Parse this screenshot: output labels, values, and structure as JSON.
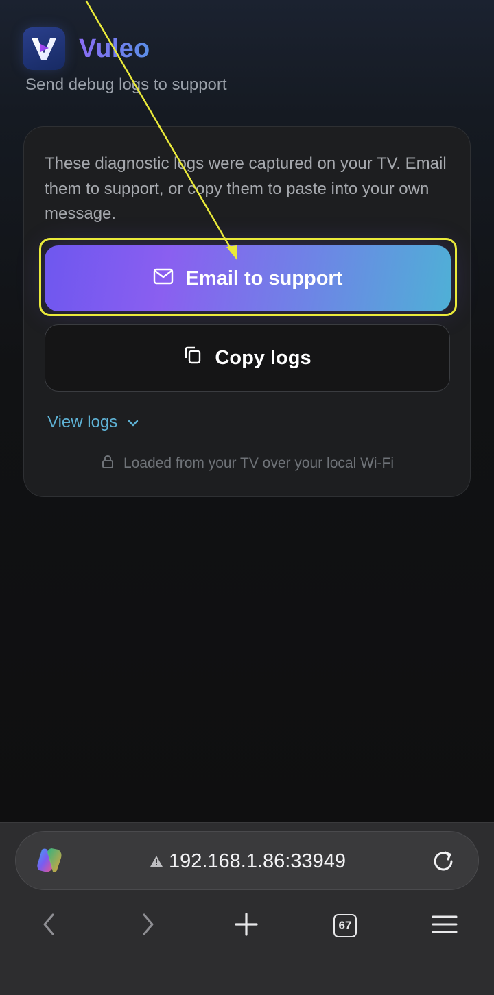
{
  "app": {
    "name": "Vuleo",
    "subtitle": "Send debug logs to support"
  },
  "card": {
    "description": "These diagnostic logs were captured on your TV. Email them to support, or copy them to paste into your own message.",
    "email_button_label": "Email to support",
    "copy_button_label": "Copy logs",
    "view_logs_label": "View logs",
    "footnote": "Loaded from your TV over your local Wi-Fi"
  },
  "browser": {
    "url": "192.168.1.86:33949",
    "tab_count": "67"
  },
  "colors": {
    "accent_purple": "#7a5cf0",
    "accent_cyan": "#4fb0d6",
    "link_blue": "#5fb3d6",
    "annotation_yellow": "#eaea3a"
  }
}
